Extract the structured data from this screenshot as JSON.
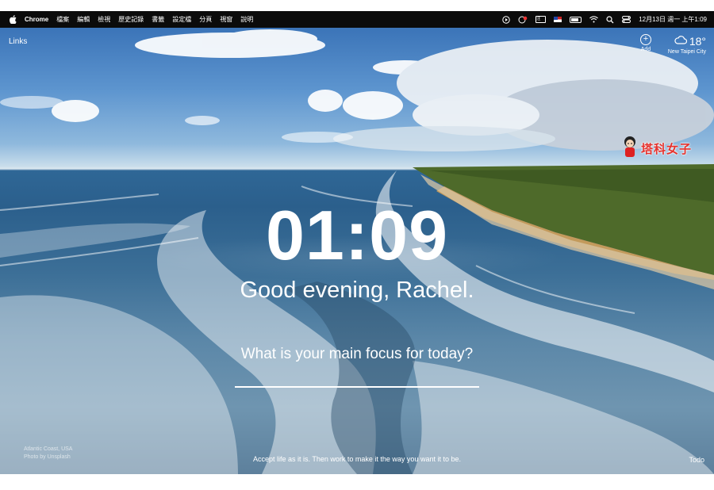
{
  "menubar": {
    "app_name": "Chrome",
    "menus": [
      "檔案",
      "編輯",
      "檢視",
      "歷史記錄",
      "書籤",
      "設定檔",
      "分頁",
      "視窗",
      "說明"
    ],
    "keyboard_label": "注",
    "datetime": "12月13日 週一 上午1:09"
  },
  "links_label": "Links",
  "add_label": "Add",
  "weather": {
    "temperature": "18°",
    "location": "New Taipei City"
  },
  "watermark_text": "塔科女子",
  "clock": "01:09",
  "greeting": "Good evening, Rachel.",
  "focus_question": "What is your main focus for today?",
  "focus_value": "",
  "quote": "Accept life as it is. Then work to make it the way you want it to be.",
  "todo_label": "Todo",
  "photo_credit": [
    "Atlantic Coast, USA",
    "Photo by Unsplash"
  ]
}
